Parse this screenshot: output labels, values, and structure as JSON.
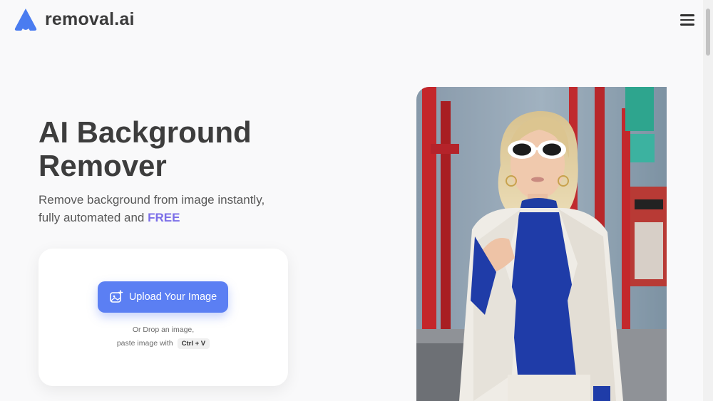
{
  "header": {
    "brand_name": "removal.ai",
    "logo_icon": "removal-ai-logo-icon",
    "menu_icon": "hamburger-menu-icon"
  },
  "hero": {
    "title_line1": "AI Background",
    "title_line2": "Remover",
    "subtitle_line1": "Remove background from image instantly,",
    "subtitle_line2_prefix": "fully automated and ",
    "subtitle_highlight": "FREE"
  },
  "upload": {
    "button_label": "Upload Your Image",
    "button_icon": "image-add-icon",
    "drop_text": "Or Drop an image,",
    "paste_text": "paste image with",
    "shortcut": "Ctrl + V"
  },
  "colors": {
    "accent": "#5b7ff3",
    "highlight": "#7b6ee8",
    "text": "#3d3d3d",
    "background": "#f9f9fa"
  }
}
